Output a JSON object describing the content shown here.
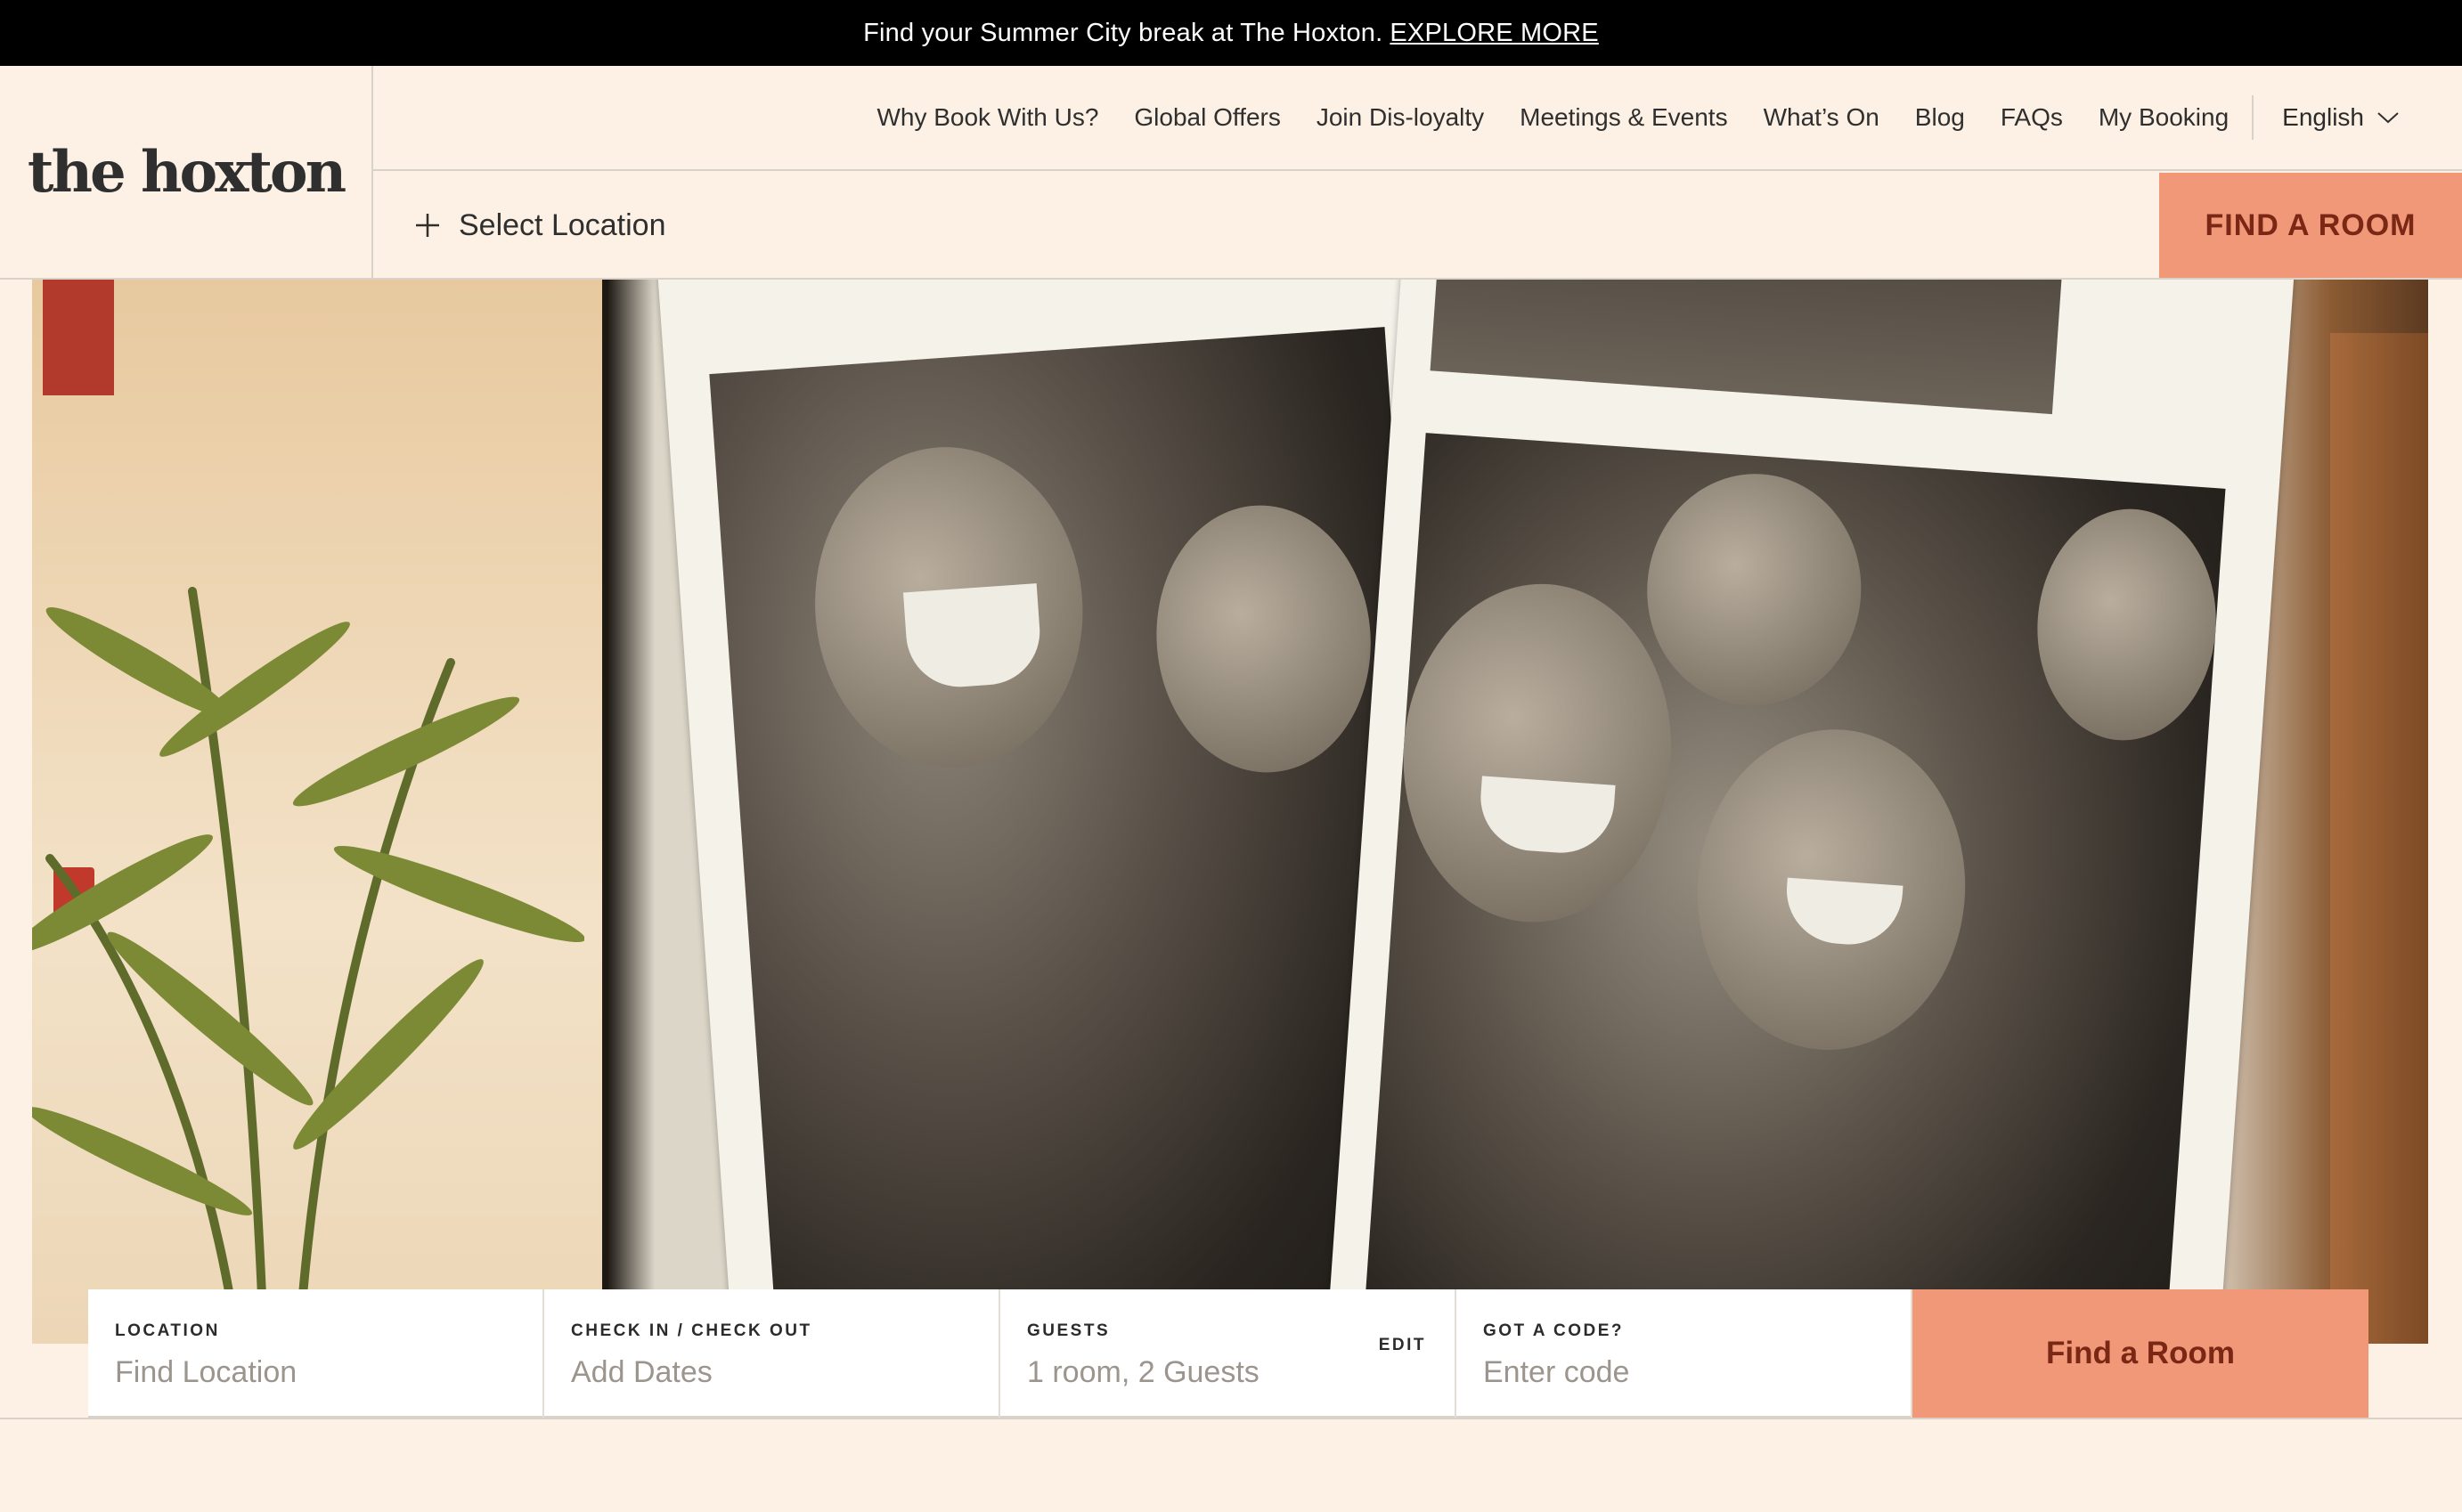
{
  "announcement": {
    "text": "Find your Summer City break at The Hoxton.",
    "link": "EXPLORE MORE"
  },
  "brand": {
    "logo": "the hoxton"
  },
  "nav": {
    "items": [
      "Why Book With Us?",
      "Global Offers",
      "Join Dis-loyalty",
      "Meetings & Events",
      "What’s On",
      "Blog",
      "FAQs",
      "My Booking"
    ],
    "language": "English"
  },
  "location_bar": {
    "select_label": "Select Location",
    "find_button": "FIND A ROOM"
  },
  "booking": {
    "location": {
      "label": "LOCATION",
      "placeholder": "Find Location"
    },
    "dates": {
      "label": "CHECK IN / CHECK OUT",
      "placeholder": "Add Dates"
    },
    "guests": {
      "label": "GUESTS",
      "value": "1 room, 2 Guests",
      "edit": "EDIT"
    },
    "code": {
      "label": "GOT A CODE?",
      "placeholder": "Enter code"
    },
    "submit": "Find a Room"
  },
  "colors": {
    "accent": "#f09878",
    "accent_text": "#7a2716",
    "background": "#fcf1e4",
    "announcement_bg": "#000000"
  }
}
